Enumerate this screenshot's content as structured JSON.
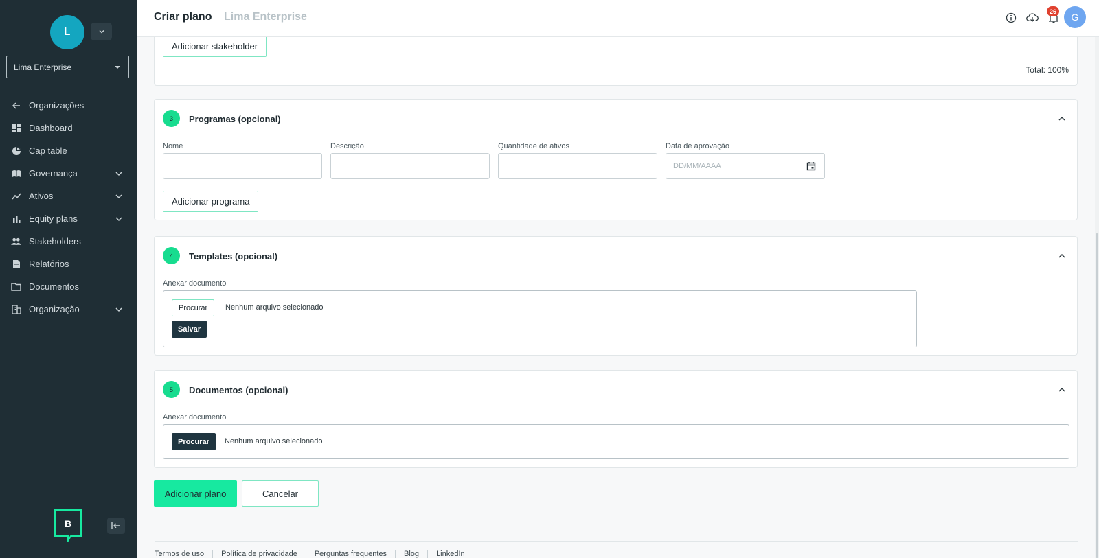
{
  "sidebar": {
    "avatar_initial": "L",
    "org_select": "Lima Enterprise",
    "items": [
      {
        "label": "Organizações",
        "icon": "arrow-left-icon"
      },
      {
        "label": "Dashboard",
        "icon": "dashboard-icon"
      },
      {
        "label": "Cap table",
        "icon": "pie-chart-icon"
      },
      {
        "label": "Governança",
        "icon": "book-icon",
        "expandable": true
      },
      {
        "label": "Ativos",
        "icon": "trend-icon",
        "expandable": true
      },
      {
        "label": "Equity plans",
        "icon": "bar-chart-icon",
        "expandable": true
      },
      {
        "label": "Stakeholders",
        "icon": "people-icon"
      },
      {
        "label": "Relatórios",
        "icon": "document-icon"
      },
      {
        "label": "Documentos",
        "icon": "folder-icon"
      },
      {
        "label": "Organização",
        "icon": "building-icon",
        "expandable": true
      }
    ],
    "brand_letter": "B"
  },
  "header": {
    "title": "Criar plano",
    "subtitle": "Lima Enterprise",
    "notification_count": "26",
    "user_initial": "G"
  },
  "stakeholder_section": {
    "add_button": "Adicionar stakeholder",
    "total": "Total: 100%"
  },
  "programs": {
    "step": "3",
    "title": "Programas (opcional)",
    "fields": {
      "name_label": "Nome",
      "description_label": "Descrição",
      "quantity_label": "Quantidade de ativos",
      "date_label": "Data de aprovação",
      "date_placeholder": "DD/MM/AAAA"
    },
    "add_button": "Adicionar programa"
  },
  "templates": {
    "step": "4",
    "title": "Templates (opcional)",
    "attach_label": "Anexar documento",
    "browse_button": "Procurar",
    "no_file": "Nenhum arquivo selecionado",
    "save_button": "Salvar"
  },
  "documents": {
    "step": "5",
    "title": "Documentos (opcional)",
    "attach_label": "Anexar documento",
    "browse_button": "Procurar",
    "no_file": "Nenhum arquivo selecionado"
  },
  "actions": {
    "add_plan": "Adicionar plano",
    "cancel": "Cancelar"
  },
  "footer": {
    "links": [
      "Termos de uso",
      "Política de privacidade",
      "Perguntas frequentes",
      "Blog",
      "LinkedIn"
    ]
  },
  "colors": {
    "sidebar_bg": "#1f2e35",
    "accent": "#17e9a0",
    "step_badge": "#17dc8f",
    "notif_badge": "#e0412f",
    "avatar": "#14a6c0"
  }
}
